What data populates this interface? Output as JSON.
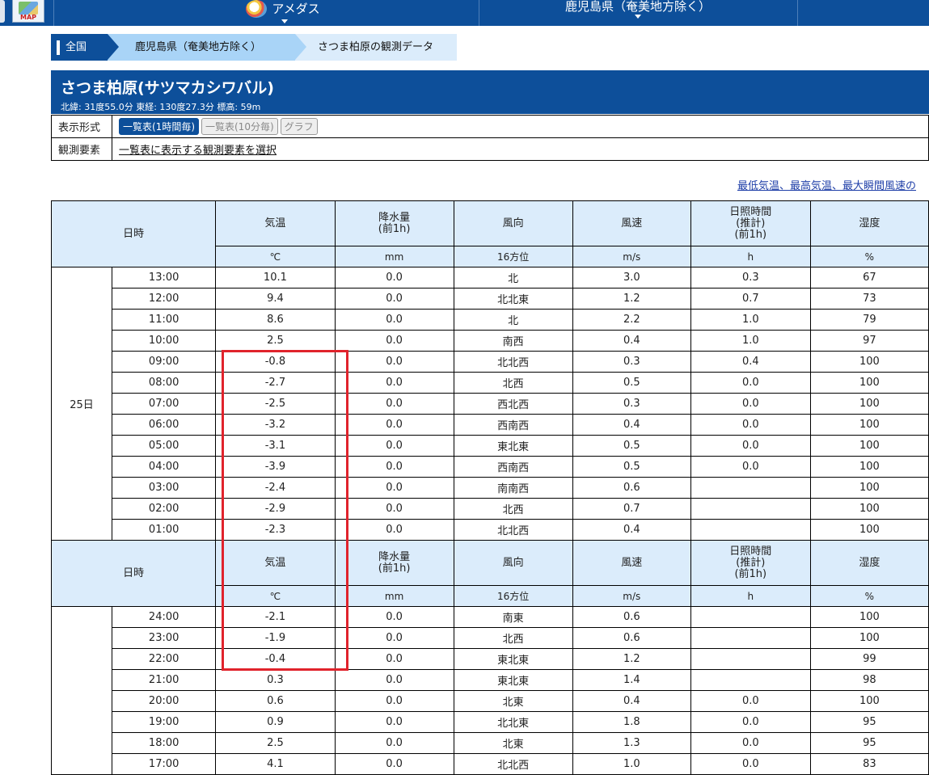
{
  "nav": {
    "map_label": "MAP",
    "amedas": "アメダス",
    "prefecture": "鹿児島県（奄美地方除く）"
  },
  "breadcrumb": {
    "home": "全国",
    "pref": "鹿児島県（奄美地方除く）",
    "current": "さつま柏原の観測データ"
  },
  "station": {
    "name": "さつま柏原(サツマカシワバル)",
    "position": "北緯: 31度55.0分 東経: 130度27.3分 標高: 59m"
  },
  "options": {
    "format_label": "表示形式",
    "btn_hourly": "一覧表(1時間毎)",
    "btn_10min": "一覧表(10分毎)",
    "btn_graph": "グラフ",
    "elements_label": "観測要素",
    "elements_link": "一覧表に表示する観測要素を選択"
  },
  "right_link": "最低気温、最高気温、最大瞬間風速の",
  "table": {
    "headers": {
      "datetime": "日時",
      "temp": "気温",
      "precip": "降水量\n(前1h)",
      "wind_dir": "風向",
      "wind_speed": "風速",
      "sunshine": "日照時間\n(推計)\n(前1h)",
      "humidity": "湿度"
    },
    "units": {
      "temp": "℃",
      "precip": "mm",
      "wind_dir": "16方位",
      "wind_speed": "m/s",
      "sunshine": "h",
      "humidity": "%"
    },
    "day1": {
      "label": "25日",
      "rows": [
        [
          "13:00",
          "10.1",
          "0.0",
          "北",
          "3.0",
          "0.3",
          "67"
        ],
        [
          "12:00",
          "9.4",
          "0.0",
          "北北東",
          "1.2",
          "0.7",
          "73"
        ],
        [
          "11:00",
          "8.6",
          "0.0",
          "北",
          "2.2",
          "1.0",
          "79"
        ],
        [
          "10:00",
          "2.5",
          "0.0",
          "南西",
          "0.4",
          "1.0",
          "97"
        ],
        [
          "09:00",
          "-0.8",
          "0.0",
          "北北西",
          "0.3",
          "0.4",
          "100"
        ],
        [
          "08:00",
          "-2.7",
          "0.0",
          "北西",
          "0.5",
          "0.0",
          "100"
        ],
        [
          "07:00",
          "-2.5",
          "0.0",
          "西北西",
          "0.3",
          "0.0",
          "100"
        ],
        [
          "06:00",
          "-3.2",
          "0.0",
          "西南西",
          "0.4",
          "0.0",
          "100"
        ],
        [
          "05:00",
          "-3.1",
          "0.0",
          "東北東",
          "0.5",
          "0.0",
          "100"
        ],
        [
          "04:00",
          "-3.9",
          "0.0",
          "西南西",
          "0.5",
          "0.0",
          "100"
        ],
        [
          "03:00",
          "-2.4",
          "0.0",
          "南南西",
          "0.6",
          "",
          "100"
        ],
        [
          "02:00",
          "-2.9",
          "0.0",
          "北西",
          "0.7",
          "",
          "100"
        ],
        [
          "01:00",
          "-2.3",
          "0.0",
          "北北西",
          "0.4",
          "",
          "100"
        ]
      ]
    },
    "day2": {
      "label": "",
      "rows": [
        [
          "24:00",
          "-2.1",
          "0.0",
          "南東",
          "0.6",
          "",
          "100"
        ],
        [
          "23:00",
          "-1.9",
          "0.0",
          "北西",
          "0.6",
          "",
          "100"
        ],
        [
          "22:00",
          "-0.4",
          "0.0",
          "東北東",
          "1.2",
          "",
          "99"
        ],
        [
          "21:00",
          "0.3",
          "0.0",
          "東北東",
          "1.4",
          "",
          "98"
        ],
        [
          "20:00",
          "0.6",
          "0.0",
          "北東",
          "0.4",
          "0.0",
          "100"
        ],
        [
          "19:00",
          "0.9",
          "0.0",
          "北北東",
          "1.8",
          "0.0",
          "95"
        ],
        [
          "18:00",
          "2.5",
          "0.0",
          "北東",
          "1.3",
          "0.0",
          "95"
        ],
        [
          "17:00",
          "4.1",
          "0.0",
          "北北西",
          "1.0",
          "0.0",
          "83"
        ]
      ]
    }
  },
  "colors": {
    "brand": "#0d4f9a",
    "header_bg": "#dbecfb",
    "highlight": "#e0232c"
  }
}
